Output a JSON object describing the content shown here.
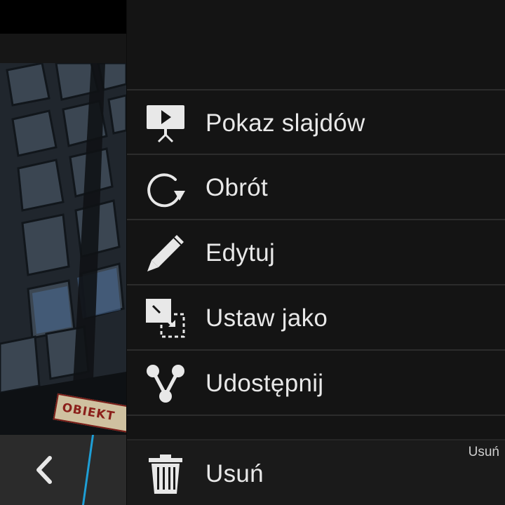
{
  "photo": {
    "sign_text": "OBIEKT"
  },
  "toolbar": {
    "back_icon": "chevron-left-icon"
  },
  "menu": {
    "items": [
      {
        "label": "Pokaz slajdów",
        "icon": "slideshow-icon"
      },
      {
        "label": "Obrót",
        "icon": "rotate-icon"
      },
      {
        "label": "Edytuj",
        "icon": "pencil-icon"
      },
      {
        "label": "Ustaw jako",
        "icon": "set-as-icon"
      },
      {
        "label": "Udostępnij",
        "icon": "share-icon"
      }
    ],
    "delete": {
      "label": "Usuń",
      "tooltip": "Usuń",
      "icon": "trash-icon"
    }
  },
  "colors": {
    "accent": "#1e9fd6",
    "menu_bg": "#141414",
    "text": "#e8e8e8"
  }
}
